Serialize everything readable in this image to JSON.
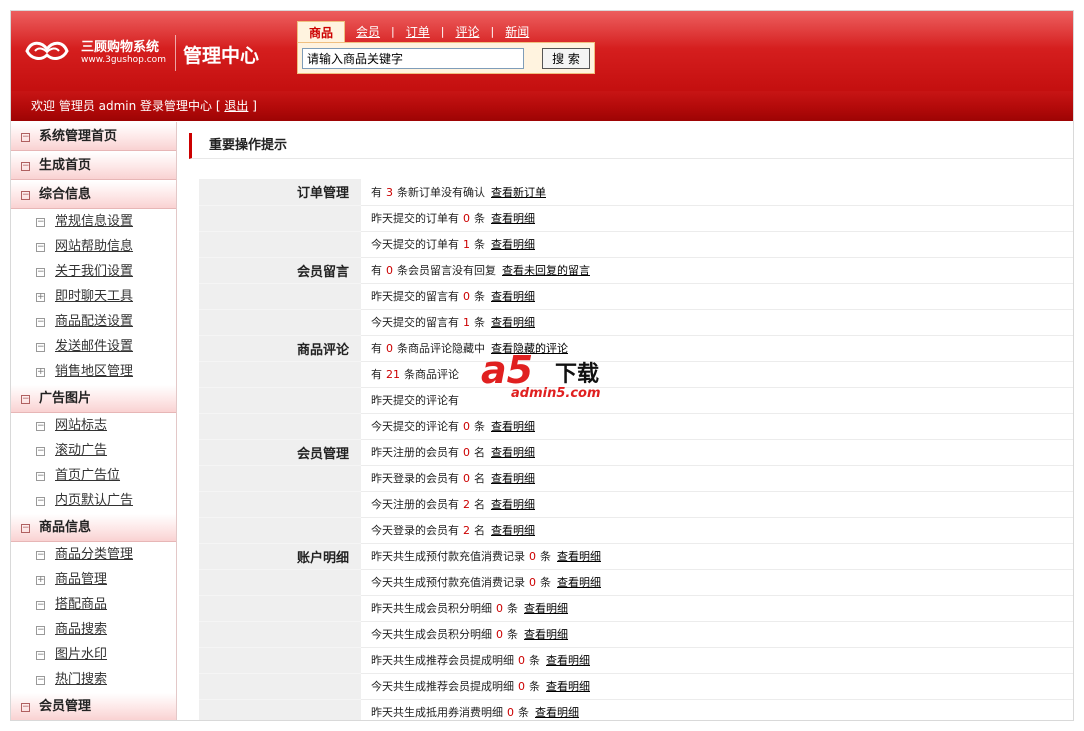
{
  "header": {
    "logo_name": "三顾购物系统",
    "logo_url": "www.3gushop.com",
    "admin_title": "管理中心"
  },
  "search": {
    "tabs": [
      {
        "label": "商品"
      },
      {
        "label": "会员"
      },
      {
        "label": "订单"
      },
      {
        "label": "评论"
      },
      {
        "label": "新闻"
      }
    ],
    "input_value": "请输入商品关键字",
    "button_label": "搜 索"
  },
  "welcome": {
    "text": "欢迎 管理员 admin 登录管理中心 [ ",
    "logout": "退出",
    "close": " ]"
  },
  "sidebar": {
    "sections": [
      {
        "label": "系统管理首页",
        "toggle": "−"
      },
      {
        "label": "生成首页",
        "toggle": "−"
      },
      {
        "label": "综合信息",
        "toggle": "−"
      },
      {
        "label": "广告图片",
        "toggle": "−"
      },
      {
        "label": "商品信息",
        "toggle": "−"
      },
      {
        "label": "会员管理",
        "toggle": "−"
      }
    ],
    "zonghe_items": [
      {
        "label": "常规信息设置",
        "toggle": "−"
      },
      {
        "label": "网站帮助信息",
        "toggle": "−"
      },
      {
        "label": "关于我们设置",
        "toggle": "−"
      },
      {
        "label": "即时聊天工具",
        "toggle": "+"
      },
      {
        "label": "商品配送设置",
        "toggle": "−"
      },
      {
        "label": "发送邮件设置",
        "toggle": "−"
      },
      {
        "label": "销售地区管理",
        "toggle": "+"
      }
    ],
    "ad_items": [
      {
        "label": "网站标志",
        "toggle": "−"
      },
      {
        "label": "滚动广告",
        "toggle": "−"
      },
      {
        "label": "首页广告位",
        "toggle": "−"
      },
      {
        "label": "内页默认广告",
        "toggle": "−"
      }
    ],
    "goods_items": [
      {
        "label": "商品分类管理",
        "toggle": "−"
      },
      {
        "label": "商品管理",
        "toggle": "+"
      },
      {
        "label": "搭配商品",
        "toggle": "−"
      },
      {
        "label": "商品搜索",
        "toggle": "−"
      },
      {
        "label": "图片水印",
        "toggle": "−"
      },
      {
        "label": "热门搜索",
        "toggle": "−"
      }
    ]
  },
  "main": {
    "title": "重要操作提示",
    "rows": [
      {
        "cat": "订单管理",
        "pre": "有",
        "num": "3",
        "post": "条新订单没有确认",
        "link": "查看新订单"
      },
      {
        "cat": "",
        "pre": "昨天提交的订单有",
        "num": "0",
        "post": "条",
        "link": "查看明细"
      },
      {
        "cat": "",
        "pre": "今天提交的订单有",
        "num": "1",
        "post": "条",
        "link": "查看明细"
      },
      {
        "cat": "会员留言",
        "pre": "有",
        "num": "0",
        "post": "条会员留言没有回复",
        "link": "查看未回复的留言"
      },
      {
        "cat": "",
        "pre": "昨天提交的留言有",
        "num": "0",
        "post": "条",
        "link": "查看明细"
      },
      {
        "cat": "",
        "pre": "今天提交的留言有",
        "num": "1",
        "post": "条",
        "link": "查看明细"
      },
      {
        "cat": "商品评论",
        "pre": "有",
        "num": "0",
        "post": "条商品评论隐藏中",
        "link": "查看隐藏的评论"
      },
      {
        "cat": "",
        "pre": "有",
        "num": "21",
        "post": "条商品评论",
        "link": ""
      },
      {
        "cat": "",
        "pre": "昨天提交的评论有",
        "num": "",
        "post": "",
        "link": ""
      },
      {
        "cat": "",
        "pre": "今天提交的评论有",
        "num": "0",
        "post": "条",
        "link": "查看明细"
      },
      {
        "cat": "会员管理",
        "pre": "昨天注册的会员有",
        "num": "0",
        "post": "名",
        "link": "查看明细"
      },
      {
        "cat": "",
        "pre": "昨天登录的会员有",
        "num": "0",
        "post": "名",
        "link": "查看明细"
      },
      {
        "cat": "",
        "pre": "今天注册的会员有",
        "num": "2",
        "post": "名",
        "link": "查看明细"
      },
      {
        "cat": "",
        "pre": "今天登录的会员有",
        "num": "2",
        "post": "名",
        "link": "查看明细"
      },
      {
        "cat": "账户明细",
        "pre": "昨天共生成预付款充值消费记录",
        "num": "0",
        "post": "条",
        "link": "查看明细"
      },
      {
        "cat": "",
        "pre": "今天共生成预付款充值消费记录",
        "num": "0",
        "post": "条",
        "link": "查看明细"
      },
      {
        "cat": "",
        "pre": "昨天共生成会员积分明细",
        "num": "0",
        "post": "条",
        "link": "查看明细"
      },
      {
        "cat": "",
        "pre": "今天共生成会员积分明细",
        "num": "0",
        "post": "条",
        "link": "查看明细"
      },
      {
        "cat": "",
        "pre": "昨天共生成推荐会员提成明细",
        "num": "0",
        "post": "条",
        "link": "查看明细"
      },
      {
        "cat": "",
        "pre": "今天共生成推荐会员提成明细",
        "num": "0",
        "post": "条",
        "link": "查看明细"
      },
      {
        "cat": "",
        "pre": "昨天共生成抵用券消费明细",
        "num": "0",
        "post": "条",
        "link": "查看明细"
      }
    ]
  },
  "watermark": {
    "letter": "a5",
    "text": "下载",
    "url": "admin5.com"
  },
  "colors": {
    "header_red": "#d61f1f",
    "accent_red": "#cc0000",
    "category_bg": "#efefef"
  }
}
